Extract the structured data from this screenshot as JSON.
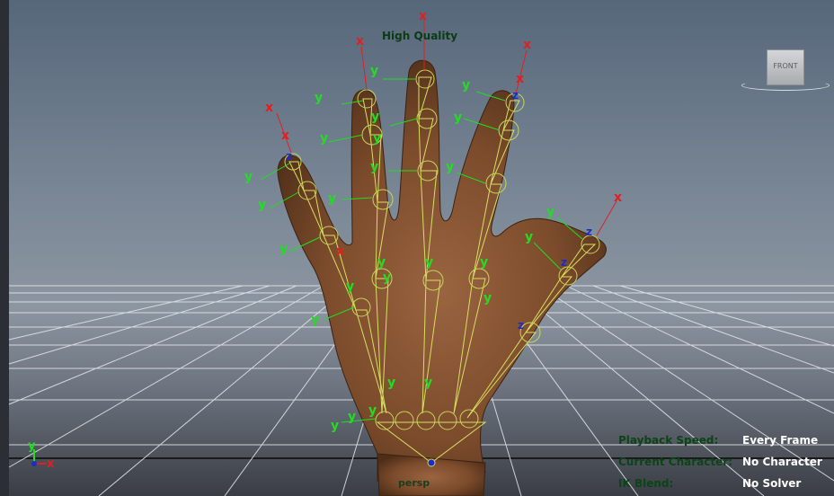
{
  "viewport": {
    "quality_label": "High Quality",
    "camera_label": "persp",
    "view_cube_label": "FRONT",
    "hud": [
      {
        "key": "Playback Speed:",
        "value": "Every Frame"
      },
      {
        "key": "Current Character:",
        "value": "No Character"
      },
      {
        "key": "IK Blend:",
        "value": "No Solver"
      }
    ],
    "axis_gizmo": {
      "y": "y",
      "x": "x"
    },
    "joint_axis_labels": {
      "x": "x",
      "y": "y",
      "z": "z"
    }
  },
  "colors": {
    "skin": "#7a4a2a",
    "joint": "#c9d35a",
    "x_axis": "#e02020",
    "y_axis": "#22dd22",
    "z_axis": "#1a2bd0",
    "grid": "#e6e8ec"
  },
  "icons": [
    "view-cube-icon",
    "axis-gizmo-icon"
  ]
}
